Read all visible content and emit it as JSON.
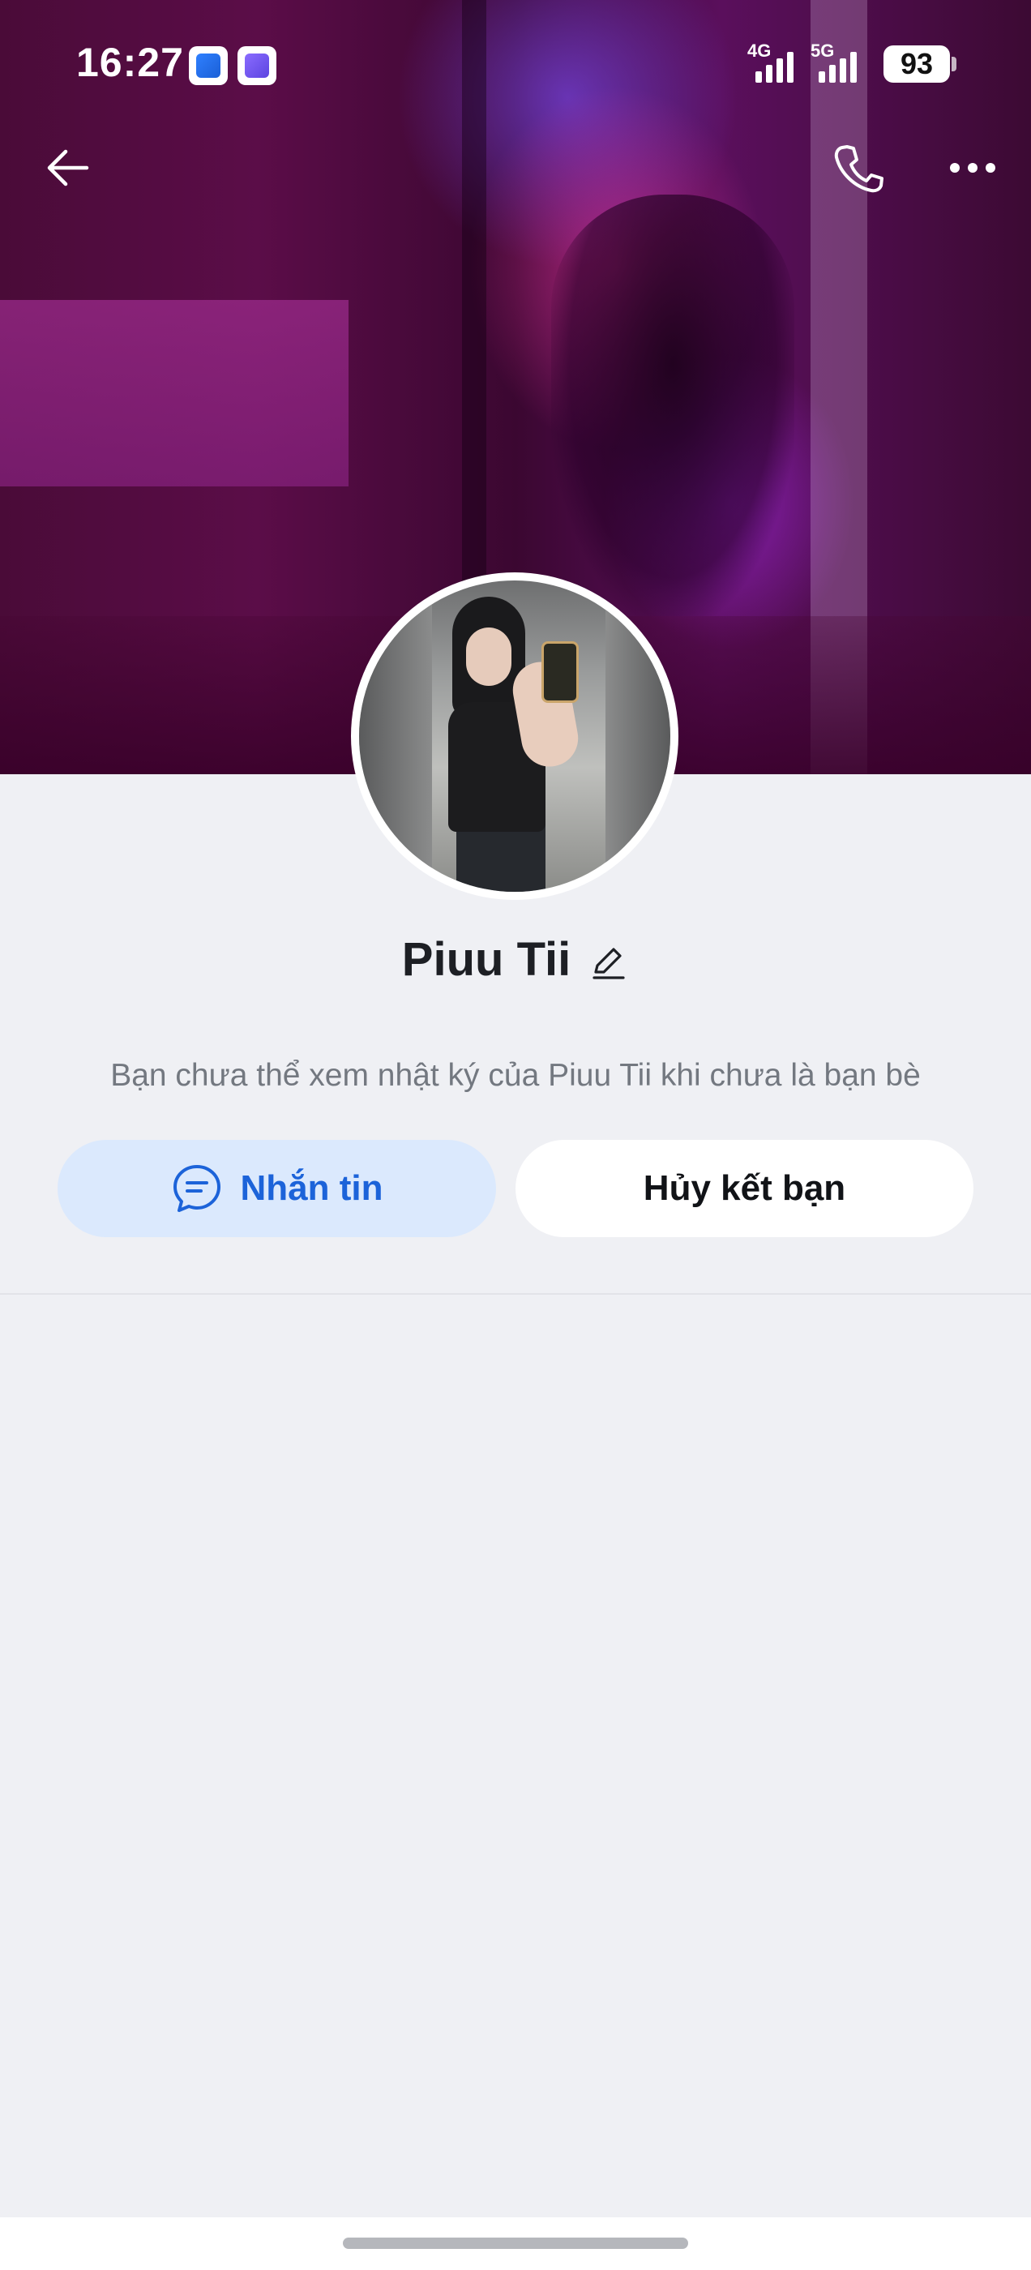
{
  "status_bar": {
    "time": "16:27",
    "network_1": "4G",
    "network_2": "5G",
    "battery": "93"
  },
  "header": {
    "back_icon": "arrow-left-icon",
    "call_icon": "phone-icon",
    "more_icon": "more-horizontal-icon"
  },
  "profile": {
    "name": "Piuu Tii",
    "edit_icon": "pencil-icon",
    "notice": "Bạn chưa thể xem nhật ký của Piuu Tii khi chưa là bạn bè"
  },
  "actions": {
    "message_label": "Nhắn tin",
    "message_icon": "chat-bubble-icon",
    "unfriend_label": "Hủy kết bạn"
  },
  "colors": {
    "accent": "#1c63d9",
    "message_button_bg": "#dbe9fd",
    "background": "#eff0f4"
  }
}
